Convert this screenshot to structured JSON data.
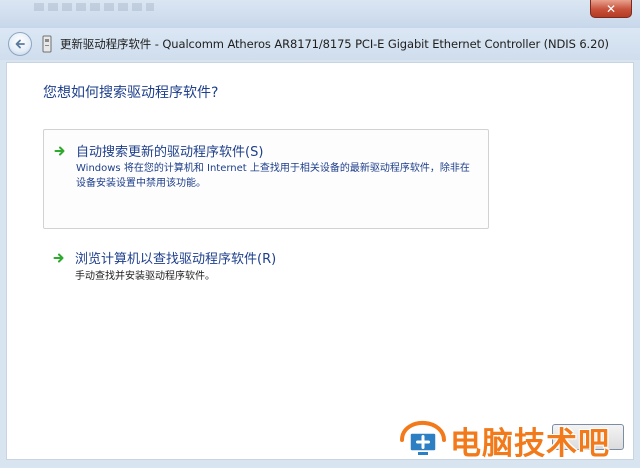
{
  "window": {
    "title": "更新驱动程序软件 - Qualcomm Atheros AR8171/8175 PCI-E Gigabit Ethernet Controller (NDIS 6.20)",
    "close_symbol": "✕"
  },
  "main": {
    "heading": "您想如何搜索驱动程序软件?",
    "options": [
      {
        "title": "自动搜索更新的驱动程序软件(S)",
        "description": "Windows 将在您的计算机和 Internet 上查找用于相关设备的最新驱动程序软件，除非在设备安装设置中禁用该功能。",
        "icon": "green-arrow-icon"
      },
      {
        "title": "浏览计算机以查找驱动程序软件(R)",
        "description": "手动查找并安装驱动程序软件。",
        "icon": "green-arrow-icon"
      }
    ]
  },
  "footer": {
    "next_label": "消"
  },
  "watermark": {
    "text": "电脑技术吧"
  },
  "colors": {
    "heading": "#1e3f8c",
    "arrow": "#2eaa2e",
    "watermark": "#f27a1a",
    "close": "#c7513a"
  }
}
